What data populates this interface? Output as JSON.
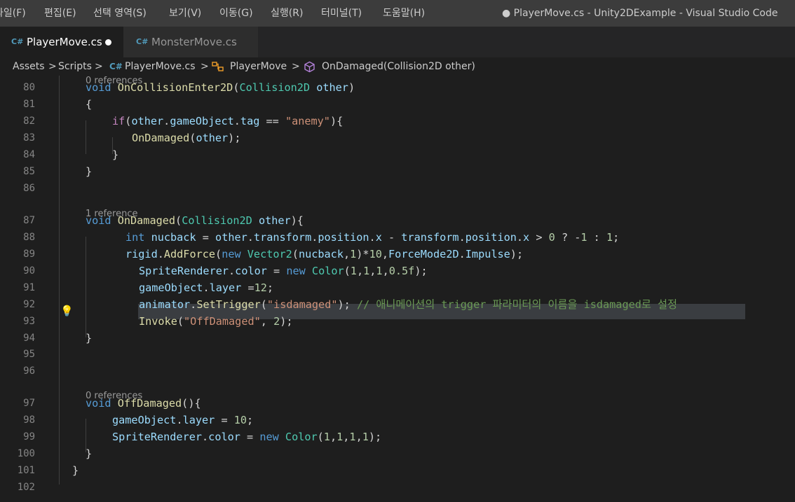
{
  "menu": [
    "파일(F)",
    "편집(E)",
    "선택 영역(S)",
    "보기(V)",
    "이동(G)",
    "실행(R)",
    "터미널(T)",
    "도움말(H)"
  ],
  "window_title": "● PlayerMove.cs - Unity2DExample - Visual Studio Code",
  "tabs": [
    {
      "label": "PlayerMove.cs",
      "active": true,
      "modified": true
    },
    {
      "label": "MonsterMove.cs",
      "active": false,
      "modified": false
    }
  ],
  "breadcrumb": {
    "assets": "Assets",
    "scripts": "Scripts",
    "file": "PlayerMove.cs",
    "class": "PlayerMove",
    "method": "OnDamaged(Collision2D other)",
    "separator": ">"
  },
  "icons": {
    "csharp": "C#",
    "class": "class-icon",
    "method": "cube-icon",
    "lightbulb": "lightbulb-icon"
  },
  "colors": {
    "keyword": "#569cd6",
    "type": "#4ec9b0",
    "function": "#dcdcaa",
    "variable": "#9cdcfe",
    "string": "#ce9178",
    "number": "#b5cea8",
    "comment": "#6a9955",
    "background": "#1e1e1e"
  },
  "codelens": {
    "line80": "0 references",
    "line87": "1 reference",
    "line97": "0 references"
  },
  "lines": [
    {
      "n": "80",
      "parts": [
        [
          "k",
          "void"
        ],
        [
          "p",
          " "
        ],
        [
          "f",
          "OnCollisionEnter2D"
        ],
        [
          "p",
          "("
        ],
        [
          "t",
          "Collision2D"
        ],
        [
          "p",
          " "
        ],
        [
          "v",
          "other"
        ],
        [
          "p",
          ")"
        ]
      ]
    },
    {
      "n": "81",
      "parts": [
        [
          "p",
          "{"
        ]
      ]
    },
    {
      "n": "82",
      "parts": [
        [
          "ctl",
          "if"
        ],
        [
          "p",
          "("
        ],
        [
          "v",
          "other"
        ],
        [
          "p",
          "."
        ],
        [
          "v",
          "gameObject"
        ],
        [
          "p",
          "."
        ],
        [
          "v",
          "tag"
        ],
        [
          "p",
          " == "
        ],
        [
          "s",
          "\"anemy\""
        ],
        [
          "p",
          "){"
        ]
      ]
    },
    {
      "n": "83",
      "parts": [
        [
          "f",
          "OnDamaged"
        ],
        [
          "p",
          "("
        ],
        [
          "v",
          "other"
        ],
        [
          "p",
          ");"
        ]
      ]
    },
    {
      "n": "84",
      "parts": [
        [
          "p",
          "}"
        ]
      ]
    },
    {
      "n": "85",
      "parts": [
        [
          "p",
          "}"
        ]
      ]
    },
    {
      "n": "86",
      "parts": []
    },
    {
      "n": "87",
      "parts": [
        [
          "k",
          "void"
        ],
        [
          "p",
          " "
        ],
        [
          "f",
          "OnDamaged"
        ],
        [
          "p",
          "("
        ],
        [
          "t",
          "Collision2D"
        ],
        [
          "p",
          " "
        ],
        [
          "v",
          "other"
        ],
        [
          "p",
          "){"
        ]
      ]
    },
    {
      "n": "88",
      "parts": [
        [
          "k",
          "int"
        ],
        [
          "p",
          " "
        ],
        [
          "v",
          "nucback"
        ],
        [
          "p",
          " = "
        ],
        [
          "v",
          "other"
        ],
        [
          "p",
          "."
        ],
        [
          "v",
          "transform"
        ],
        [
          "p",
          "."
        ],
        [
          "v",
          "position"
        ],
        [
          "p",
          "."
        ],
        [
          "v",
          "x"
        ],
        [
          "p",
          " - "
        ],
        [
          "v",
          "transform"
        ],
        [
          "p",
          "."
        ],
        [
          "v",
          "position"
        ],
        [
          "p",
          "."
        ],
        [
          "v",
          "x"
        ],
        [
          "p",
          " > "
        ],
        [
          "n",
          "0"
        ],
        [
          "p",
          " ? -"
        ],
        [
          "n",
          "1"
        ],
        [
          "p",
          " : "
        ],
        [
          "n",
          "1"
        ],
        [
          "p",
          ";"
        ]
      ]
    },
    {
      "n": "89",
      "parts": [
        [
          "v",
          "rigid"
        ],
        [
          "p",
          "."
        ],
        [
          "f",
          "AddForce"
        ],
        [
          "p",
          "("
        ],
        [
          "k",
          "new"
        ],
        [
          "p",
          " "
        ],
        [
          "t",
          "Vector2"
        ],
        [
          "p",
          "("
        ],
        [
          "v",
          "nucback"
        ],
        [
          "p",
          ","
        ],
        [
          "n",
          "1"
        ],
        [
          "p",
          ")*"
        ],
        [
          "n",
          "10"
        ],
        [
          "p",
          ","
        ],
        [
          "v",
          "ForceMode2D"
        ],
        [
          "p",
          "."
        ],
        [
          "v",
          "Impulse"
        ],
        [
          "p",
          ");"
        ]
      ]
    },
    {
      "n": "90",
      "parts": [
        [
          "v",
          "SpriteRenderer"
        ],
        [
          "p",
          "."
        ],
        [
          "v",
          "color"
        ],
        [
          "p",
          " = "
        ],
        [
          "k",
          "new"
        ],
        [
          "p",
          " "
        ],
        [
          "t",
          "Color"
        ],
        [
          "p",
          "("
        ],
        [
          "n",
          "1"
        ],
        [
          "p",
          ","
        ],
        [
          "n",
          "1"
        ],
        [
          "p",
          ","
        ],
        [
          "n",
          "1"
        ],
        [
          "p",
          ","
        ],
        [
          "n",
          "0.5f"
        ],
        [
          "p",
          ");"
        ]
      ]
    },
    {
      "n": "91",
      "parts": [
        [
          "v",
          "gameObject"
        ],
        [
          "p",
          "."
        ],
        [
          "v",
          "layer"
        ],
        [
          "p",
          " ="
        ],
        [
          "n",
          "12"
        ],
        [
          "p",
          ";"
        ]
      ]
    },
    {
      "n": "92",
      "parts": [
        [
          "v",
          "animator"
        ],
        [
          "p",
          "."
        ],
        [
          "f",
          "SetTrigger"
        ],
        [
          "p",
          "("
        ],
        [
          "s",
          "\"isdamaged\""
        ],
        [
          "p",
          ");"
        ],
        [
          "p",
          " "
        ],
        [
          "c",
          "// 애니메이션의 trigger 파라미터의 이름을 isdamaged로 설정"
        ]
      ]
    },
    {
      "n": "93",
      "parts": [
        [
          "f",
          "Invoke"
        ],
        [
          "p",
          "("
        ],
        [
          "s",
          "\"OffDamaged\""
        ],
        [
          "p",
          ", "
        ],
        [
          "n",
          "2"
        ],
        [
          "p",
          ");"
        ]
      ]
    },
    {
      "n": "94",
      "parts": [
        [
          "p",
          "}"
        ]
      ]
    },
    {
      "n": "95",
      "parts": []
    },
    {
      "n": "96",
      "parts": []
    },
    {
      "n": "97",
      "parts": [
        [
          "k",
          "void"
        ],
        [
          "p",
          " "
        ],
        [
          "f",
          "OffDamaged"
        ],
        [
          "p",
          "(){"
        ]
      ]
    },
    {
      "n": "98",
      "parts": [
        [
          "v",
          "gameObject"
        ],
        [
          "p",
          "."
        ],
        [
          "v",
          "layer"
        ],
        [
          "p",
          " = "
        ],
        [
          "n",
          "10"
        ],
        [
          "p",
          ";"
        ]
      ]
    },
    {
      "n": "99",
      "parts": [
        [
          "v",
          "SpriteRenderer"
        ],
        [
          "p",
          "."
        ],
        [
          "v",
          "color"
        ],
        [
          "p",
          " = "
        ],
        [
          "k",
          "new"
        ],
        [
          "p",
          " "
        ],
        [
          "t",
          "Color"
        ],
        [
          "p",
          "("
        ],
        [
          "n",
          "1"
        ],
        [
          "p",
          ","
        ],
        [
          "n",
          "1"
        ],
        [
          "p",
          ","
        ],
        [
          "n",
          "1"
        ],
        [
          "p",
          ","
        ],
        [
          "n",
          "1"
        ],
        [
          "p",
          ");"
        ]
      ]
    },
    {
      "n": "100",
      "parts": [
        [
          "p",
          "}"
        ]
      ]
    },
    {
      "n": "101",
      "parts": [
        [
          "p",
          "}"
        ]
      ]
    },
    {
      "n": "102",
      "parts": []
    }
  ]
}
